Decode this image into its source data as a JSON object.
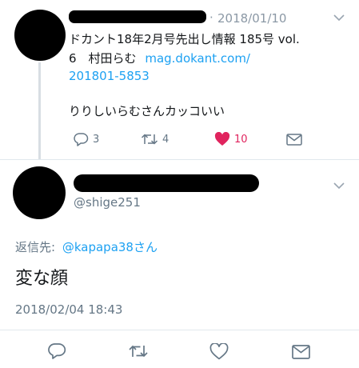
{
  "quoted_tweet": {
    "dot": "·",
    "timestamp": "2018/01/10",
    "text_line1": "ドカント18年2月号先出し情報 185号 vol.",
    "text_line2_plain": "6　村田らむ",
    "link_part1": "mag.dokant.com/",
    "link_part2": "201801-5853",
    "text_line3": "りりしいらむさんカッコいい",
    "reply_count": "3",
    "retweet_count": "4",
    "like_count": "10",
    "icons": {
      "reply": "reply-icon",
      "retweet": "retweet-icon",
      "like": "heart-filled-icon",
      "message": "mail-icon",
      "menu": "chevron-down-icon"
    }
  },
  "main_tweet": {
    "handle": "@shige251",
    "reply_to_label": "返信先:",
    "reply_to_user": "@kapapa38さん",
    "text": "変な顔",
    "timestamp": "2018/02/04 18:43"
  },
  "action_bar": {
    "icons": [
      "reply-icon",
      "retweet-icon",
      "heart-icon",
      "mail-icon"
    ]
  },
  "colors": {
    "accent": "#1da1f2",
    "like": "#e0245e",
    "muted": "#8b98a5"
  }
}
